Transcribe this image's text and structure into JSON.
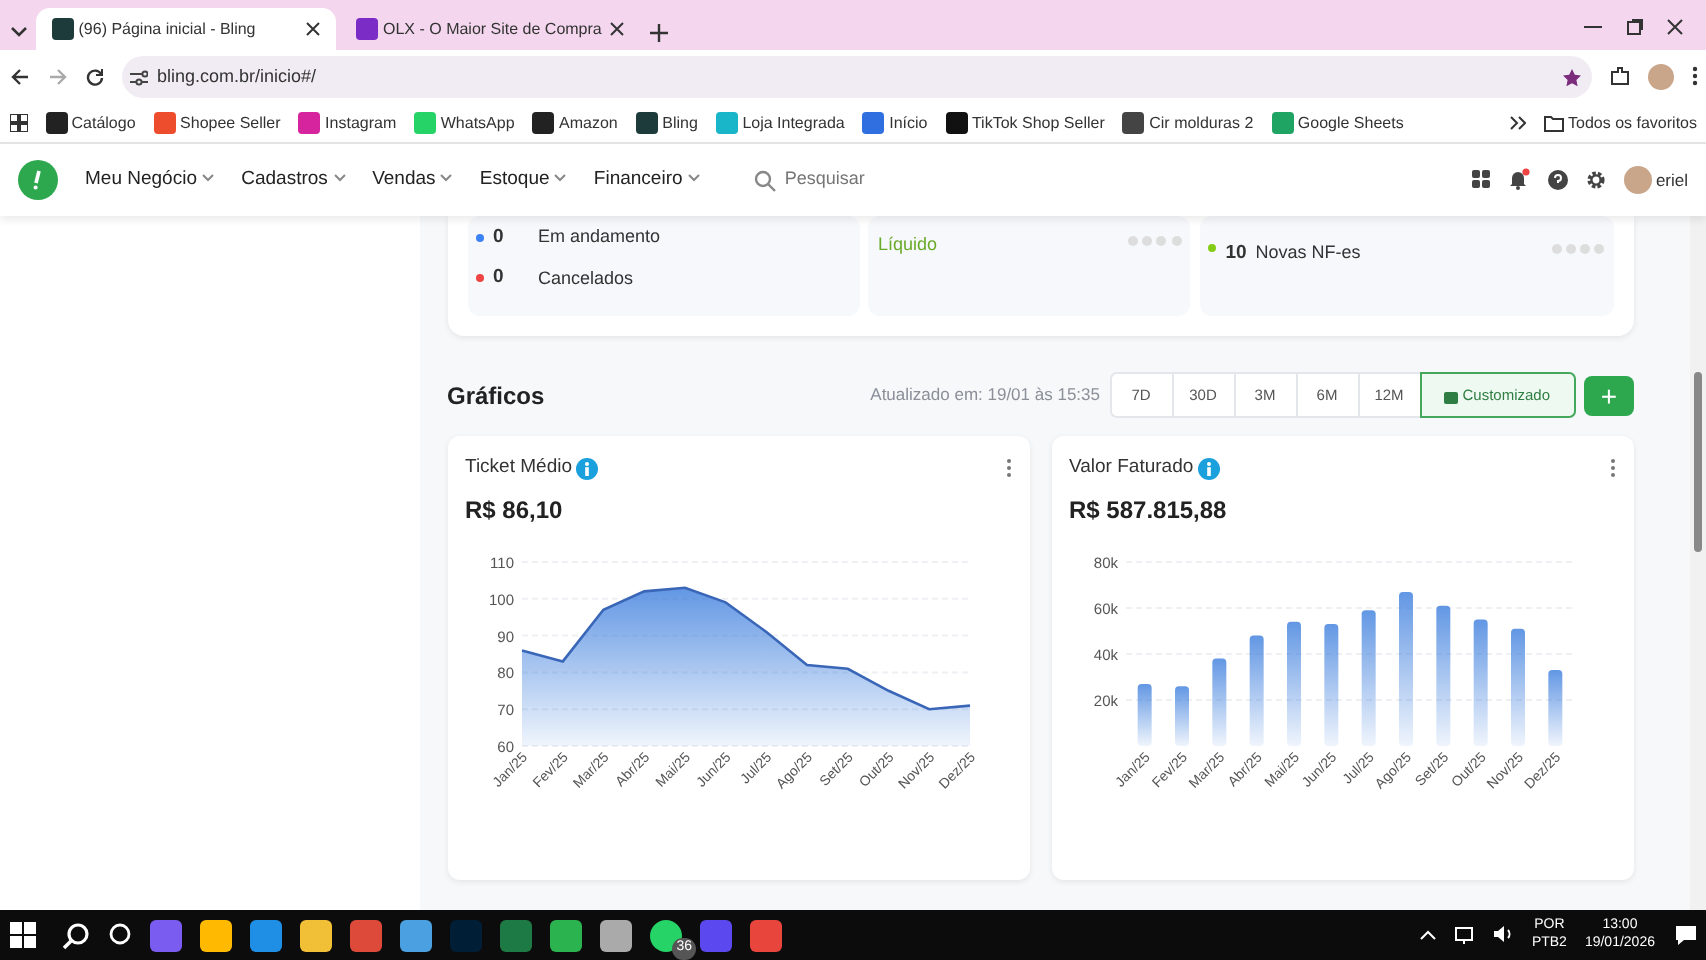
{
  "browser": {
    "tabs": [
      {
        "title": "(96) Página inicial - Bling",
        "selected": true
      },
      {
        "title": "OLX - O Maior Site de Compra",
        "selected": false
      }
    ],
    "address": "bling.com.br/inicio#/",
    "bookmarks": [
      "Catálogo",
      "Shopee Seller",
      "Instagram",
      "WhatsApp",
      "Amazon",
      "Bling",
      "Loja Integrada",
      "Início",
      "TikTok Shop Seller",
      "Cir molduras 2",
      "Google Sheets"
    ],
    "favorites": "Todos os favoritos"
  },
  "app_nav": {
    "menu": [
      "Meu Negócio",
      "Cadastros",
      "Vendas",
      "Estoque",
      "Financeiro"
    ],
    "search": {
      "placeholder": "Pesquisar"
    },
    "user": "eriel"
  },
  "summary": {
    "orders": [
      {
        "count": "0",
        "label": "Em andamento",
        "color": "#3b82f6"
      },
      {
        "count": "0",
        "label": "Cancelados",
        "color": "#ef4444"
      }
    ],
    "net_label": "Líquido",
    "invoices": {
      "count": "10",
      "label": "Novas NF-es",
      "color": "#84cc16"
    }
  },
  "charts_section": {
    "title": "Gráficos",
    "updated": "Atualizado em: 19/01 às 15:35",
    "periods": [
      {
        "label": "7D",
        "selected": false
      },
      {
        "label": "30D",
        "selected": false
      },
      {
        "label": "3M",
        "selected": false
      },
      {
        "label": "6M",
        "selected": false
      },
      {
        "label": "12M",
        "selected": false
      },
      {
        "label": "Customizado",
        "selected": true
      }
    ],
    "add_button": "+",
    "cards": [
      {
        "title": "Ticket Médio",
        "value": "R$ 86,10",
        "chart_data": {
          "type": "area",
          "categories": [
            "Jan/25",
            "Fev/25",
            "Mar/25",
            "Abr/25",
            "Mai/25",
            "Jun/25",
            "Jul/25",
            "Ago/25",
            "Set/25",
            "Out/25",
            "Nov/25",
            "Dez/25"
          ],
          "series": [
            {
              "color": "#3b7ddd",
              "values": [
                86,
                83,
                97,
                102,
                103,
                99,
                91,
                82,
                81,
                75,
                70,
                71
              ]
            }
          ],
          "grid": true,
          "ylim": [
            60,
            110
          ],
          "yticks": [
            60,
            70,
            80,
            90,
            100,
            110
          ]
        }
      },
      {
        "title": "Valor Faturado",
        "value": "R$ 587.815,88",
        "chart_data": {
          "type": "bar",
          "categories": [
            "Jan/25",
            "Fev/25",
            "Mar/25",
            "Abr/25",
            "Mai/25",
            "Jun/25",
            "Jul/25",
            "Ago/25",
            "Set/25",
            "Out/25",
            "Nov/25",
            "Dez/25"
          ],
          "series": [
            {
              "color": "#3b7ddd",
              "values": [
                27000,
                26000,
                38000,
                48000,
                54000,
                53000,
                59000,
                67000,
                61000,
                55000,
                51000,
                33000
              ]
            }
          ],
          "grid": true,
          "ylim": [
            0,
            80000
          ],
          "yticks": [
            {
              "value": 20000,
              "label": "20k"
            },
            {
              "value": 40000,
              "label": "40k"
            },
            {
              "value": 60000,
              "label": "60k"
            },
            {
              "value": 80000,
              "label": "80k"
            }
          ]
        }
      }
    ]
  },
  "taskbar": {
    "whatsapp_badge": "36",
    "language": "POR",
    "layout": "PTB2",
    "time": "13:00",
    "date": "19/01/2026"
  }
}
